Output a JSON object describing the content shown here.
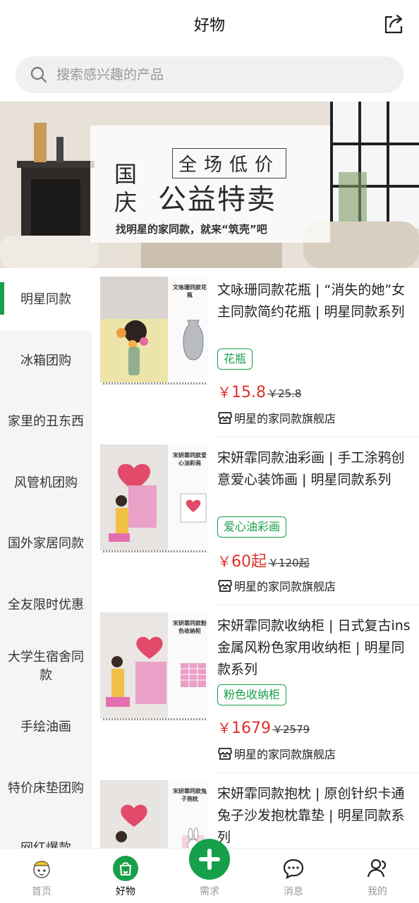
{
  "header": {
    "title": "好物"
  },
  "search": {
    "placeholder": "搜索感兴趣的产品"
  },
  "banner": {
    "tag": "全场低价",
    "guo": "国",
    "qing": "庆",
    "main": "公益特卖",
    "subtitle": "找明星的家同款，就来“筑壳”吧"
  },
  "sidebar": {
    "items": [
      {
        "label": "明星同款"
      },
      {
        "label": "冰箱团购"
      },
      {
        "label": "家里的丑东西"
      },
      {
        "label": "风管机团购"
      },
      {
        "label": "国外家居同款"
      },
      {
        "label": "全友限时优惠"
      },
      {
        "label": "大学生宿舍同款"
      },
      {
        "label": "手绘油画"
      },
      {
        "label": "特价床垫团购"
      },
      {
        "label": "网红爆款"
      }
    ]
  },
  "products": [
    {
      "title": "文咏珊同款花瓶 | “消失的她”女主同款简约花瓶 | 明星同款系列",
      "tag": "花瓶",
      "price": "15.8",
      "price_suffix": "",
      "orig": "￥25.8",
      "store": "明星的家同款旗舰店",
      "caption": "文咏珊同款花瓶"
    },
    {
      "title": "宋妍霏同款油彩画 | 手工涂鸦创意爱心装饰画 | 明星同款系列",
      "tag": "爱心油彩画",
      "price": "60",
      "price_suffix": "起",
      "orig": "￥120起",
      "store": "明星的家同款旗舰店",
      "caption": "宋妍霏同款爱心油彩画"
    },
    {
      "title": "宋妍霏同款收纳柜 | 日式复古ins金属风粉色家用收纳柜 | 明星同款系列",
      "tag": "粉色收纳柜",
      "price": "1679",
      "price_suffix": "",
      "orig": "￥2579",
      "store": "明星的家同款旗舰店",
      "caption": "宋妍霏同款粉色收纳柜"
    },
    {
      "title": "宋妍霏同款抱枕 | 原创针织卡通兔子沙发抱枕靠垫 | 明星同款系列",
      "tag": "",
      "price": "",
      "price_suffix": "",
      "orig": "",
      "store": "",
      "caption": "宋妍霏同款兔子抱枕"
    }
  ],
  "currency": "￥",
  "tabbar": {
    "home": "首页",
    "goods": "好物",
    "demand": "需求",
    "messages": "消息",
    "me": "我的"
  },
  "colors": {
    "accent": "#17a04a",
    "price": "#e0302b"
  }
}
